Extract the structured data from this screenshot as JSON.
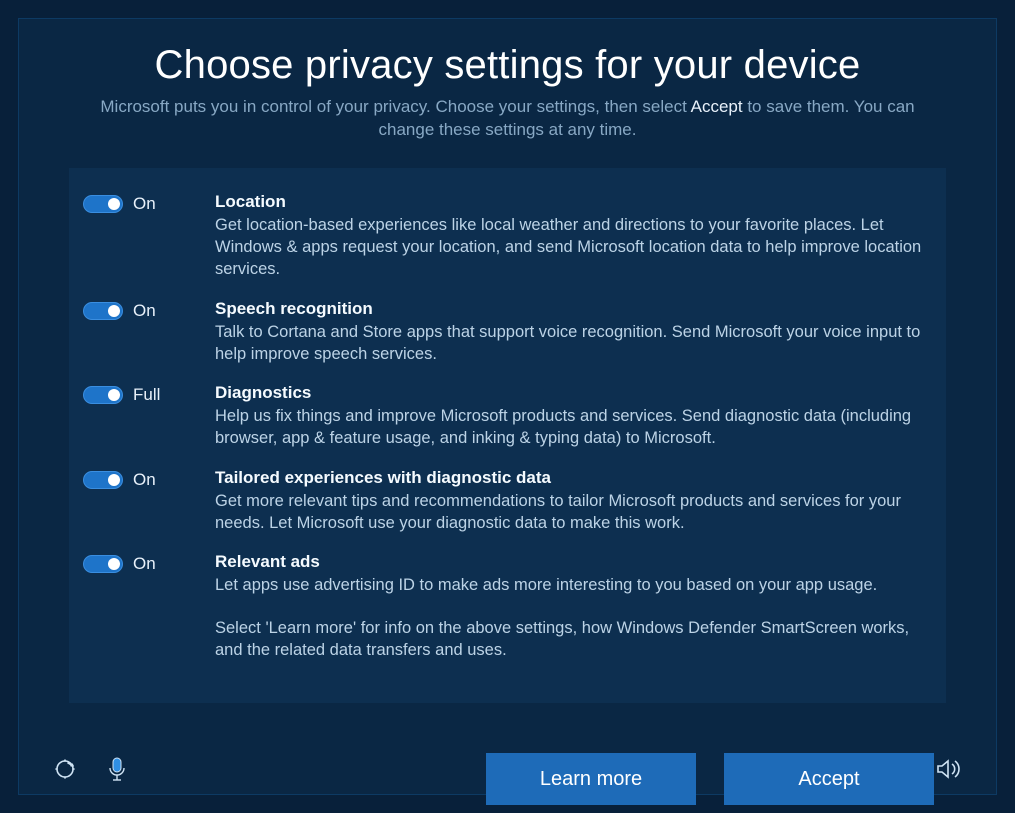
{
  "header": {
    "title": "Choose privacy settings for your device",
    "subtitle_pre": "Microsoft puts you in control of your privacy.  Choose your settings, then select ",
    "subtitle_accept": "Accept",
    "subtitle_post": " to save them. You can change these settings at any time."
  },
  "options": [
    {
      "state": "On",
      "title": "Location",
      "desc": "Get location-based experiences like local weather and directions to your favorite places.  Let Windows & apps request your location, and send Microsoft location data to help improve location services."
    },
    {
      "state": "On",
      "title": "Speech recognition",
      "desc": "Talk to Cortana and Store apps that support voice recognition.  Send Microsoft your voice input to help improve speech services."
    },
    {
      "state": "Full",
      "title": "Diagnostics",
      "desc": "Help us fix things and improve Microsoft products and services.  Send diagnostic data (including browser, app & feature usage, and inking & typing data) to Microsoft."
    },
    {
      "state": "On",
      "title": "Tailored experiences with diagnostic data",
      "desc": "Get more relevant tips and recommendations to tailor Microsoft products and services for your needs. Let Microsoft use your diagnostic data to make this work."
    },
    {
      "state": "On",
      "title": "Relevant ads",
      "desc": "Let apps use advertising ID to make ads more interesting to you based on your app usage."
    }
  ],
  "footnote": "Select 'Learn more' for info on the above settings, how Windows Defender SmartScreen works, and the related data transfers and uses.",
  "buttons": {
    "learn_more": "Learn more",
    "accept": "Accept"
  }
}
